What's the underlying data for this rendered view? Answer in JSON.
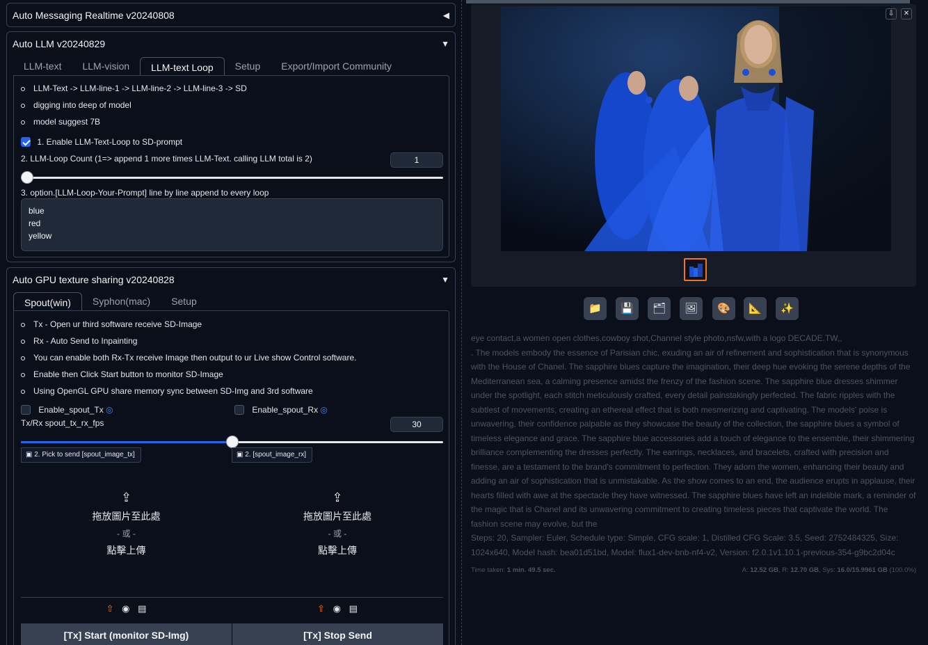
{
  "messaging": {
    "title": "Auto Messaging Realtime v20240808",
    "toggle": "◀"
  },
  "llm": {
    "title": "Auto LLM v20240829",
    "toggle": "▼",
    "tabs": [
      "LLM-text",
      "LLM-vision",
      "LLM-text Loop",
      "Setup",
      "Export/Import Community"
    ],
    "active_tab": "LLM-text Loop",
    "bullets": [
      "LLM-Text -> LLM-line-1 -> LLM-line-2 -> LLM-line-3 -> SD",
      "digging into deep of model",
      "model suggest 7B"
    ],
    "enable_label": "1. Enable LLM-Text-Loop to SD-prompt",
    "enable_checked": true,
    "loop_count_label": "2. LLM-Loop Count (1=> append 1 more times LLM-Text. calling LLM total is 2)",
    "loop_count_value": "1",
    "loop_count_fraction": 0,
    "prompt_label": "3. option.[LLM-Loop-Your-Prompt] line by line append to every loop",
    "prompt_lines": [
      "blue",
      "red",
      "yellow"
    ]
  },
  "gpu": {
    "title": "Auto GPU texture sharing v20240828",
    "toggle": "▼",
    "tabs": [
      "Spout(win)",
      "Syphon(mac)",
      "Setup"
    ],
    "active_tab": "Spout(win)",
    "bullets": [
      "Tx - Open ur third software receive SD-Image",
      "Rx - Auto Send to Inpainting",
      "You can enable both Rx-Tx receive Image then output to ur Live show Control software.",
      "Enable then Click Start button to monitor SD-Image",
      "Using OpenGL GPU share memory sync between SD-Img and 3rd software"
    ],
    "tx_label": "Enable_spout_Tx",
    "rx_label": "Enable_spout_Rx",
    "fps_label": "Tx/Rx spout_tx_rx_fps",
    "fps_value": "30",
    "fps_fraction": 0.5,
    "img_left_label": "2. Pick to send [spout_image_tx]",
    "img_right_label": "2. [spout_image_rx]",
    "drop_text": "拖放圖片至此處",
    "or_text": "- 或 -",
    "click_text": "點擊上傳",
    "btn_start": "[Tx] Start (monitor SD-Img)",
    "btn_stop": "[Tx] Stop Send"
  },
  "output": {
    "prompt_line": "eye contact,a women open clothes,cowboy shot,Channel style photo,nsfw,with a logo DECADE.TW,,",
    "description": ". The models embody the essence of Parisian chic, exuding an air of refinement and sophistication that is synonymous with the House of Chanel. The sapphire blues capture the imagination, their deep hue evoking the serene depths of the Mediterranean sea, a calming presence amidst the frenzy of the fashion scene. The sapphire blue dresses shimmer under the spotlight, each stitch meticulously crafted, every detail painstakingly perfected. The fabric ripples with the subtlest of movements, creating an ethereal effect that is both mesmerizing and captivating. The models' poise is unwavering, their confidence palpable as they showcase the beauty of the collection, the sapphire blues a symbol of timeless elegance and grace. The sapphire blue accessories add a touch of elegance to the ensemble, their shimmering brilliance complementing the dresses perfectly. The earrings, necklaces, and bracelets, crafted with precision and finesse, are a testament to the brand's commitment to perfection. They adorn the women, enhancing their beauty and adding an air of sophistication that is unmistakable. As the show comes to an end, the audience erupts in applause, their hearts filled with awe at the spectacle they have witnessed. The sapphire blues have left an indelible mark, a reminder of the magic that is Chanel and its unwavering commitment to creating timeless pieces that captivate the world. The fashion scene may evolve, but the",
    "params": "Steps: 20, Sampler: Euler, Schedule type: Simple, CFG scale: 1, Distilled CFG Scale: 3.5, Seed: 2752484325, Size: 1024x640, Model hash: bea01d51bd, Model: flux1-dev-bnb-nf4-v2, Version: f2.0.1v1.10.1-previous-354-g9bc2d04c",
    "time_prefix": "Time taken: ",
    "time_value": "1 min. 49.5 sec.",
    "mem_a_label": "A: ",
    "mem_a": "12.52 GB",
    "mem_r_label": ", R: ",
    "mem_r": "12.70 GB",
    "mem_sys_label": ", Sys: ",
    "mem_sys": "16.0/15.9961 GB",
    "mem_pct": " (100.0%)"
  },
  "colors": {
    "accent": "#2563eb",
    "bg": "#0b0f19",
    "thumb_border": "#f97316"
  }
}
